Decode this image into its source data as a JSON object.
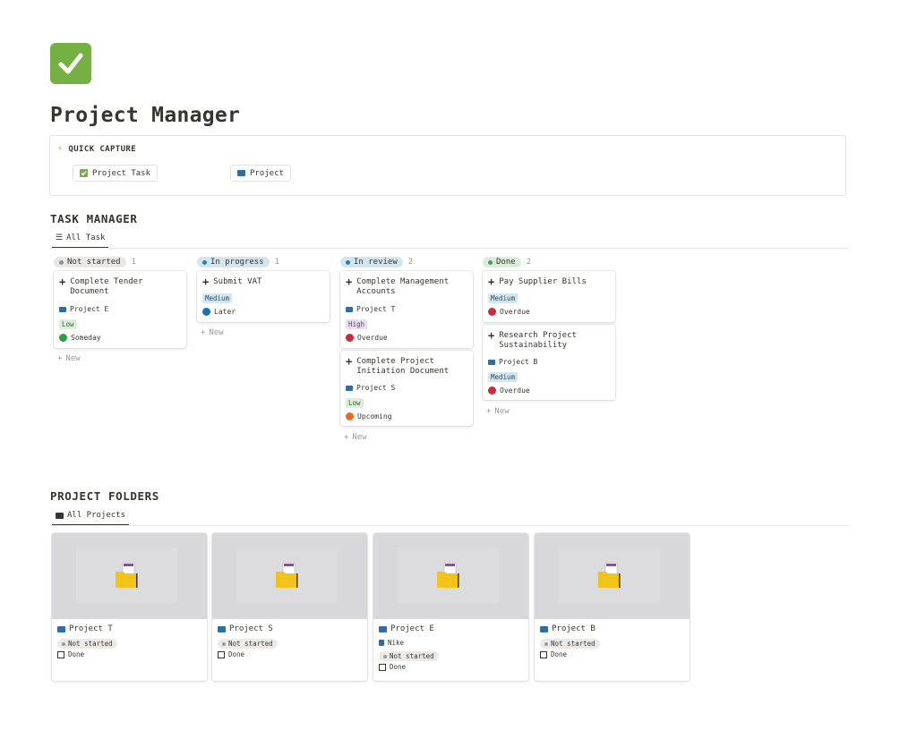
{
  "page": {
    "title": "Project Manager",
    "icon": "green-checkmark-icon",
    "icon_color": "#74b042"
  },
  "quick_capture": {
    "heading": "QUICK CAPTURE",
    "heading_icon": "lightning-icon",
    "buttons": [
      {
        "label": "Project Task",
        "icon": "checkbox-icon"
      },
      {
        "label": "Project",
        "icon": "folder-icon"
      }
    ]
  },
  "task_manager": {
    "title": "TASK MANAGER",
    "view_tab": "All Task",
    "new_label": "New",
    "columns": [
      {
        "status": "Not started",
        "count": "1",
        "pill_bg": "#e9e8e6",
        "dot": "#91918e",
        "cards": [
          {
            "title_line1": "Complete Tender",
            "title_line2": "Document",
            "project": "Project E",
            "priority": "Low",
            "timing": "Someday",
            "timing_color": "#2e9e44"
          }
        ]
      },
      {
        "status": "In progress",
        "count": "1",
        "pill_bg": "#d3e5ef",
        "dot": "#2e7bb4",
        "cards": [
          {
            "title_line1": "Submit VAT",
            "priority": "Medium",
            "timing": "Later",
            "timing_color": "#1d6fb8"
          }
        ]
      },
      {
        "status": "In review",
        "count": "2",
        "pill_bg": "#d3e5ef",
        "dot": "#2e7bb4",
        "cards": [
          {
            "title_line1": "Complete Management",
            "title_line2": "Accounts",
            "project": "Project T",
            "priority": "High",
            "timing": "Overdue",
            "timing_color": "#d1293b"
          },
          {
            "title_line1": "Complete Project",
            "title_line2": "Initiation Document",
            "project": "Project S",
            "priority": "Low",
            "timing": "Upcoming",
            "timing_color": "#e8691f"
          }
        ]
      },
      {
        "status": "Done",
        "count": "2",
        "pill_bg": "#dbeddb",
        "dot": "#4d9a57",
        "cards": [
          {
            "title_line1": "Pay Supplier Bills",
            "priority": "Medium",
            "timing": "Overdue",
            "timing_color": "#d1293b"
          },
          {
            "title_line1": "Research Project",
            "title_line2": "Sustainability",
            "project": "Project B",
            "priority": "Medium",
            "timing": "Overdue",
            "timing_color": "#d1293b"
          }
        ]
      }
    ]
  },
  "project_folders": {
    "title": "PROJECT FOLDERS",
    "view_tab": "All Projects",
    "projects": [
      {
        "name": "Project T",
        "status": "Not started",
        "done_label": "Done"
      },
      {
        "name": "Project S",
        "status": "Not started",
        "done_label": "Done"
      },
      {
        "name": "Project E",
        "client": "Nike",
        "status": "Not started",
        "done_label": "Done"
      },
      {
        "name": "Project B",
        "status": "Not started",
        "done_label": "Done"
      }
    ]
  }
}
